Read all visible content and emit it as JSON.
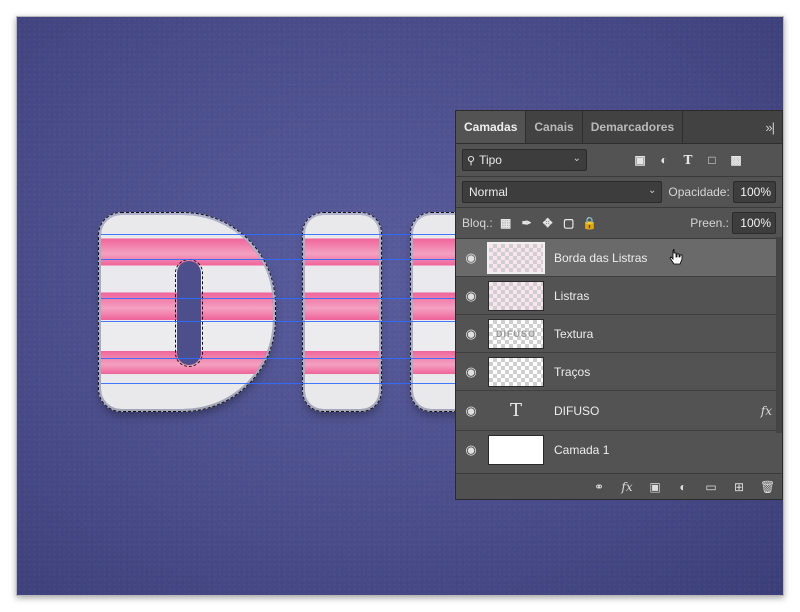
{
  "panel": {
    "tabs": [
      {
        "label": "Camadas"
      },
      {
        "label": "Canais"
      },
      {
        "label": "Demarcadores"
      }
    ],
    "menu_icon": "panel-menu-icon",
    "filter": {
      "value": "Tipo"
    },
    "filter_icons": [
      "image-filter-icon",
      "adjustment-filter-icon",
      "type-filter-icon",
      "shape-filter-icon",
      "smart-object-filter-icon"
    ],
    "blend_mode": "Normal",
    "opacity_label": "Opacidade:",
    "opacity_value": "100%",
    "lock_label": "Bloq.:",
    "fill_label": "Preen.:",
    "fill_value": "100%",
    "layers": [
      {
        "name": "Borda das Listras",
        "selected": true
      },
      {
        "name": "Listras"
      },
      {
        "name": "Textura"
      },
      {
        "name": "Traços"
      },
      {
        "name": "DIFUSO",
        "type": "text",
        "fx": "fx"
      },
      {
        "name": "Camada 1"
      }
    ],
    "texture_thumb_text": "DIFUSO",
    "type_thumb_glyph": "T",
    "bottom_icons": [
      "link-layers-icon",
      "fx-icon",
      "mask-icon",
      "adjustment-layer-icon",
      "group-folder-icon",
      "new-layer-icon",
      "trash-icon"
    ]
  },
  "colors": {
    "canvas_bg": "#4a4d8a",
    "stripe_pink": "#f0639a",
    "panel_bg": "#535353",
    "selected_row": "#6a6a6a",
    "guide_blue": "#2f6cff"
  }
}
